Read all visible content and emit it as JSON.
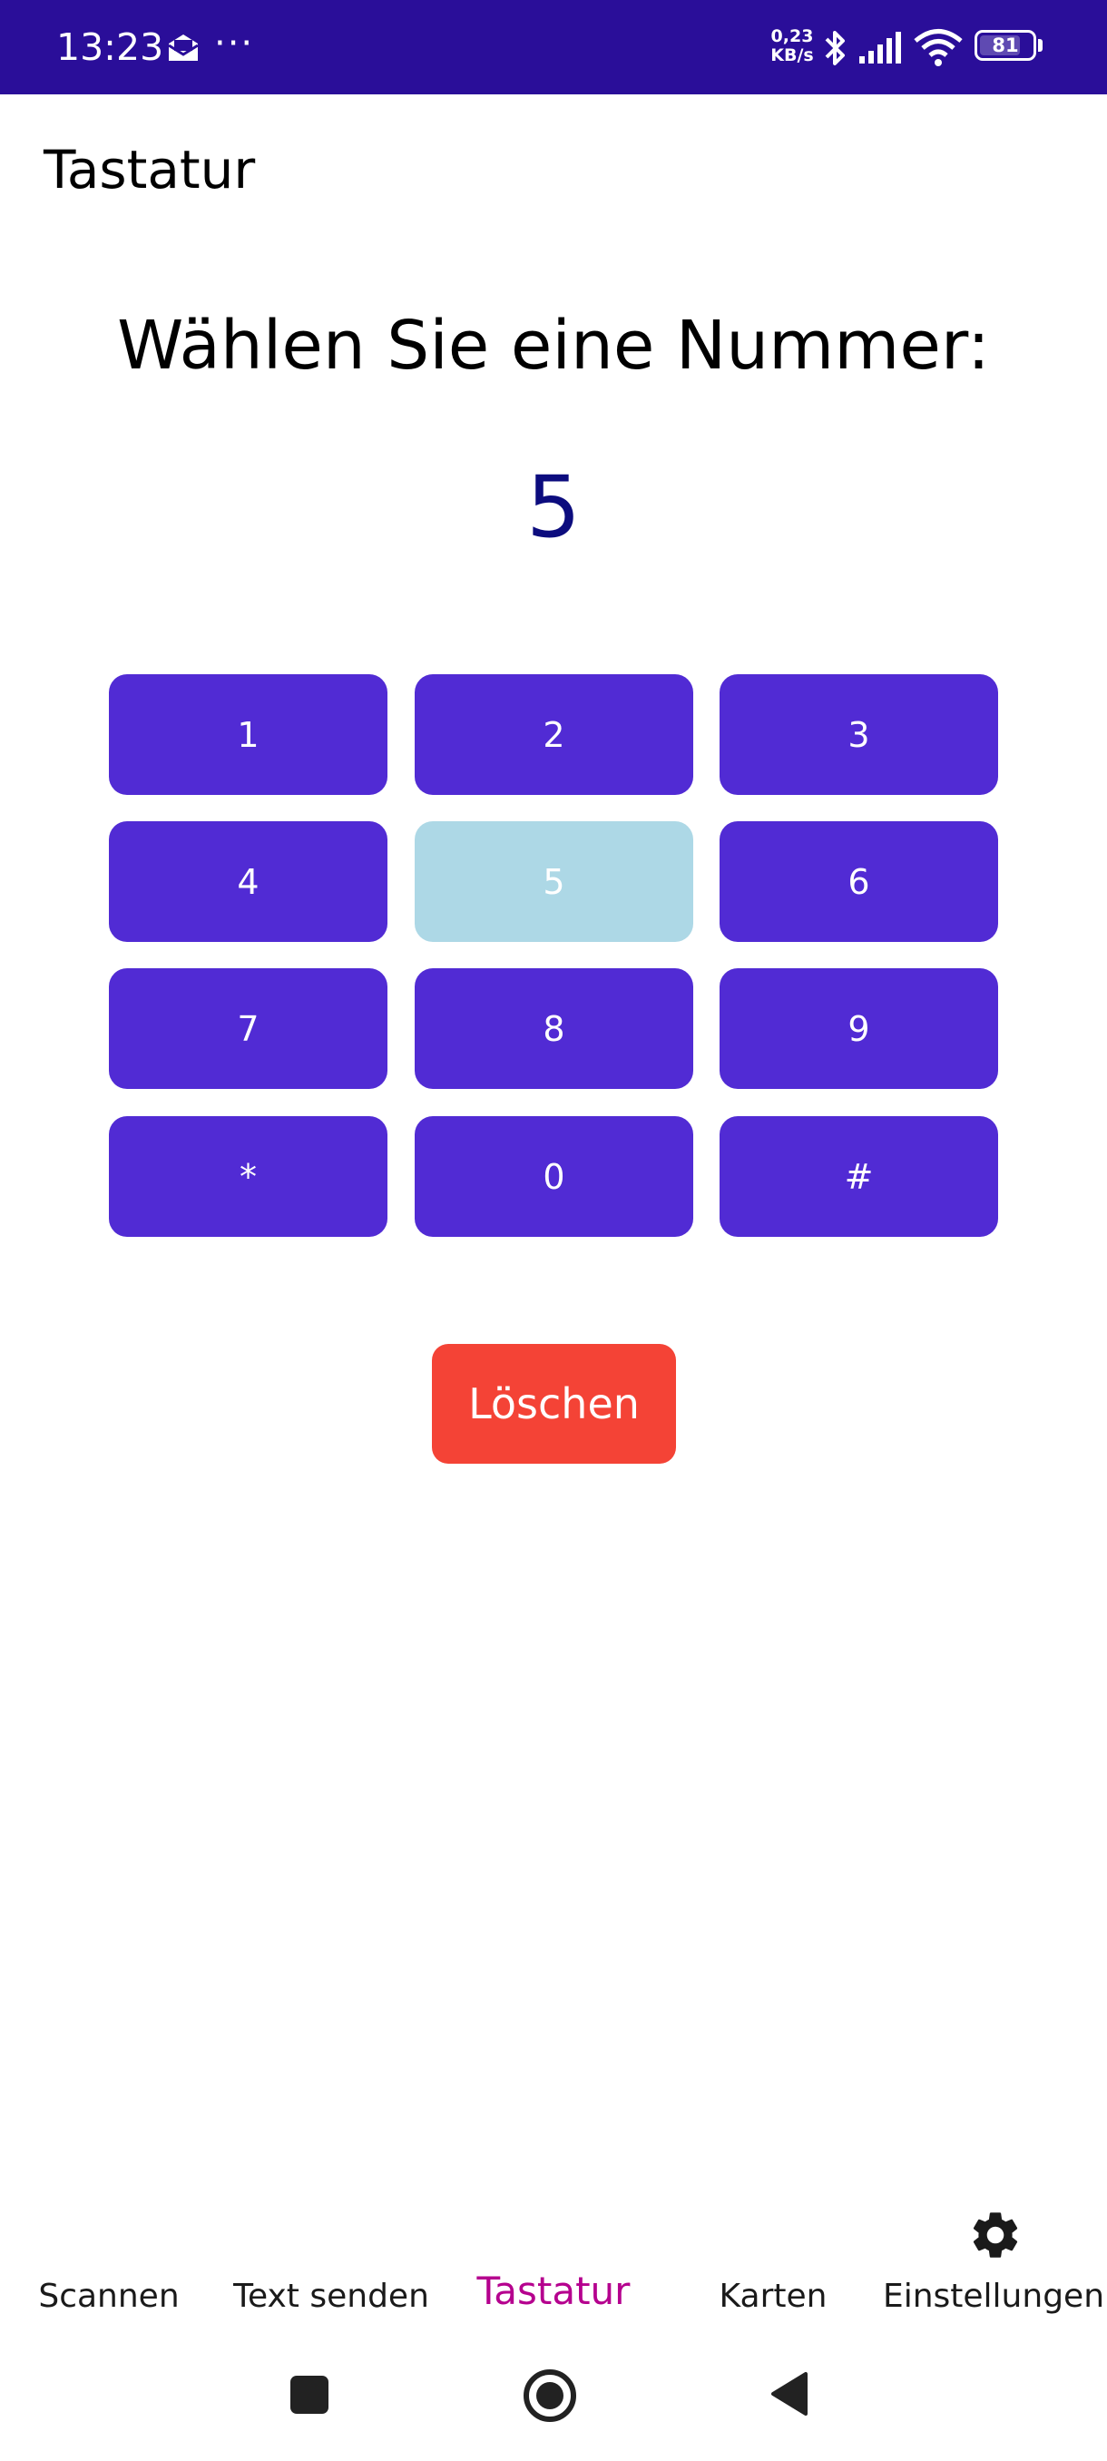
{
  "status_bar": {
    "time": "13:23",
    "overflow": "···",
    "speed_value": "0,23",
    "speed_unit": "KB/s",
    "battery": "81",
    "battery_level": 0.81,
    "icons": [
      "mail-icon",
      "bluetooth-icon",
      "signal-icon",
      "wifi-icon",
      "battery-icon"
    ]
  },
  "appbar": {
    "title": "Tastatur"
  },
  "main": {
    "prompt": "Wählen Sie eine Nummer:",
    "selected_number": "5",
    "keys": [
      "1",
      "2",
      "3",
      "4",
      "5",
      "6",
      "7",
      "8",
      "9",
      "*",
      "0",
      "#"
    ],
    "selected_key": "5",
    "clear_label": "Löschen"
  },
  "tabs": {
    "items": [
      {
        "label": "Scannen"
      },
      {
        "label": "Text senden"
      },
      {
        "label": "Tastatur"
      },
      {
        "label": "Karten"
      },
      {
        "label": "Einstellungen",
        "icon": "gear-icon"
      }
    ],
    "active": "Tastatur"
  },
  "colors": {
    "status_bar": "#2a0e99",
    "key": "#512bd4",
    "key_selected": "#add8e6",
    "clear": "#f44336",
    "number": "#0c0c7e",
    "active_tab": "#b5008e"
  }
}
